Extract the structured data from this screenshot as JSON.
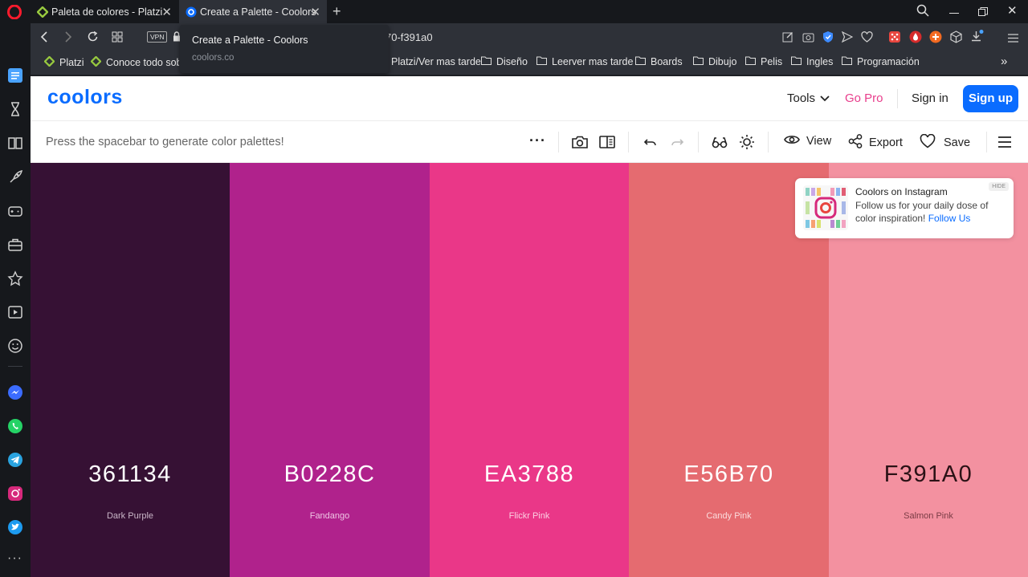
{
  "browser": {
    "tabs": [
      {
        "title": "Paleta de colores - Platzi"
      },
      {
        "title": "Create a Palette - Coolors"
      }
    ],
    "address": {
      "url_fragment": "70-f391a0",
      "vpn_label": "VPN"
    },
    "tooltip": {
      "title": "Create a Palette - Coolors",
      "domain": "coolors.co"
    },
    "bookmarks": [
      "Platzi",
      "Conoce todo sobr",
      "Platzi/Ver mas tarde",
      "Diseño",
      "Leerver mas tarde",
      "Boards",
      "Dibujo",
      "Pelis",
      "Ingles",
      "Programación"
    ],
    "more_bookmarks": "»"
  },
  "nav": {
    "logo": "coolors",
    "tools": "Tools",
    "gopro": "Go Pro",
    "signin": "Sign in",
    "signup": "Sign up"
  },
  "toolbar": {
    "hint": "Press the spacebar to generate color palettes!",
    "more": "···",
    "view": "View",
    "export": "Export",
    "save": "Save"
  },
  "palette": [
    {
      "hex": "361134",
      "name": "Dark Purple",
      "bg": "#361134",
      "fg": "#ffffff",
      "sub": "#c9b6c7"
    },
    {
      "hex": "B0228C",
      "name": "Fandango",
      "bg": "#B0228C",
      "fg": "#ffffff",
      "sub": "#efc4e4"
    },
    {
      "hex": "EA3788",
      "name": "Flickr Pink",
      "bg": "#EA3788",
      "fg": "#ffffff",
      "sub": "#fbd0e2"
    },
    {
      "hex": "E56B70",
      "name": "Candy Pink",
      "bg": "#E56B70",
      "fg": "#ffffff",
      "sub": "#fbdcdd"
    },
    {
      "hex": "F391A0",
      "name": "Salmon Pink",
      "bg": "#F391A0",
      "fg": "#2b1216",
      "sub": "#7a3c45"
    }
  ],
  "promo": {
    "hide": "HIDE",
    "title": "Coolors on Instagram",
    "text": "Follow us for your daily dose of color inspiration!",
    "link": "Follow Us"
  },
  "colors": {
    "brand": "#0a6cff",
    "gopro": "#e83e8c",
    "chrome_dark": "#16181c",
    "chrome_mid": "#2e3138"
  }
}
